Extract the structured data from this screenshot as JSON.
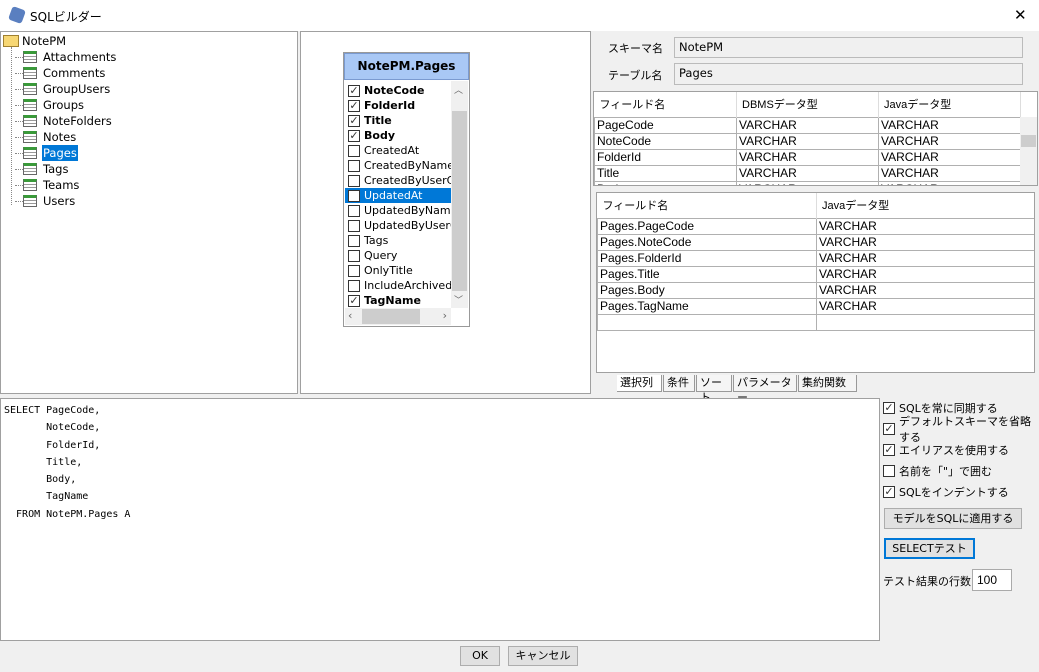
{
  "window": {
    "title": "SQLビルダー",
    "close": "✕"
  },
  "tree": {
    "root": "NotePM",
    "items": [
      "Attachments",
      "Comments",
      "GroupUsers",
      "Groups",
      "NoteFolders",
      "Notes",
      "Pages",
      "Tags",
      "Teams",
      "Users"
    ],
    "selected": "Pages"
  },
  "table_box": {
    "title": "NotePM.Pages",
    "columns": [
      {
        "name": "NoteCode",
        "checked": true
      },
      {
        "name": "FolderId",
        "checked": true
      },
      {
        "name": "Title",
        "checked": true
      },
      {
        "name": "Body",
        "checked": true
      },
      {
        "name": "CreatedAt",
        "checked": false
      },
      {
        "name": "CreatedByName",
        "checked": false
      },
      {
        "name": "CreatedByUserCode",
        "checked": false
      },
      {
        "name": "UpdatedAt",
        "checked": false
      },
      {
        "name": "UpdatedByName",
        "checked": false
      },
      {
        "name": "UpdatedByUserCode",
        "checked": false
      },
      {
        "name": "Tags",
        "checked": false
      },
      {
        "name": "Query",
        "checked": false
      },
      {
        "name": "OnlyTitle",
        "checked": false
      },
      {
        "name": "IncludeArchived",
        "checked": false
      },
      {
        "name": "TagName",
        "checked": true
      }
    ],
    "highlighted": "UpdatedAt"
  },
  "schema": {
    "label": "スキーマ名",
    "value": "NotePM"
  },
  "table": {
    "label": "テーブル名",
    "value": "Pages"
  },
  "fields_grid": {
    "headers": [
      "フィールド名",
      "DBMSデータ型",
      "Javaデータ型"
    ],
    "rows": [
      [
        "PageCode",
        "VARCHAR",
        "VARCHAR"
      ],
      [
        "NoteCode",
        "VARCHAR",
        "VARCHAR"
      ],
      [
        "FolderId",
        "VARCHAR",
        "VARCHAR"
      ],
      [
        "Title",
        "VARCHAR",
        "VARCHAR"
      ],
      [
        "Body",
        "VARCHAR",
        "VARCHAR"
      ]
    ]
  },
  "selected_grid": {
    "headers": [
      "フィールド名",
      "Javaデータ型"
    ],
    "rows": [
      [
        "Pages.PageCode",
        "VARCHAR"
      ],
      [
        "Pages.NoteCode",
        "VARCHAR"
      ],
      [
        "Pages.FolderId",
        "VARCHAR"
      ],
      [
        "Pages.Title",
        "VARCHAR"
      ],
      [
        "Pages.Body",
        "VARCHAR"
      ],
      [
        "Pages.TagName",
        "VARCHAR"
      ],
      [
        "",
        ""
      ]
    ]
  },
  "tabs": [
    "選択列",
    "条件",
    "ソート",
    "パラメーター",
    "集約関数"
  ],
  "sql": "SELECT PageCode,\n       NoteCode,\n       FolderId,\n       Title,\n       Body,\n       TagName\n  FROM NotePM.Pages A",
  "options": [
    {
      "label": "SQLを常に同期する",
      "checked": true
    },
    {
      "label": "デフォルトスキーマを省略する",
      "checked": true
    },
    {
      "label": "エイリアスを使用する",
      "checked": true
    },
    {
      "label": "名前を「\"」で囲む",
      "checked": false
    },
    {
      "label": "SQLをインデントする",
      "checked": true
    }
  ],
  "apply_button": "モデルをSQLに適用する",
  "test_button": "SELECTテスト",
  "rows_label": "テスト結果の行数",
  "rows_value": "100",
  "ok": "OK",
  "cancel": "キャンセル"
}
